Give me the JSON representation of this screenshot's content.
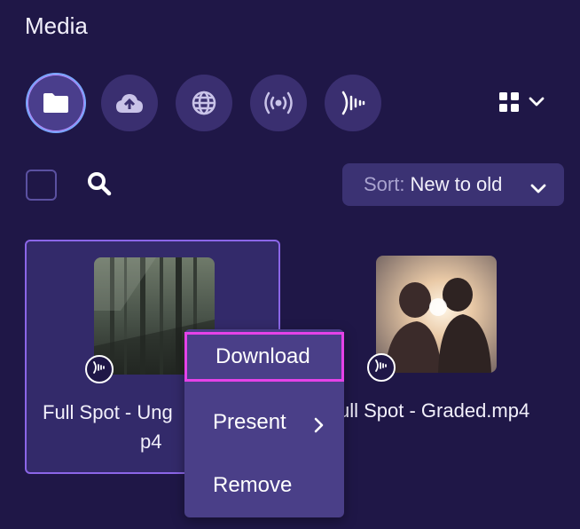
{
  "header": {
    "title": "Media"
  },
  "sources": [
    {
      "name": "folder",
      "icon": "folder-icon",
      "active": true
    },
    {
      "name": "cloud-upload",
      "icon": "cloud-upload-icon"
    },
    {
      "name": "web",
      "icon": "globe-icon"
    },
    {
      "name": "broadcast",
      "icon": "broadcast-icon"
    },
    {
      "name": "audio",
      "icon": "audio-wave-icon"
    }
  ],
  "toolbar": {
    "sort_label": "Sort:",
    "sort_value": "New to old"
  },
  "files": [
    {
      "name_line1": "Full Spot - Ung",
      "name_line2": "p4",
      "selected": true
    },
    {
      "name_line1": "ull Spot - Graded.mp4",
      "name_line2": ""
    }
  ],
  "context_menu": {
    "items": [
      {
        "label": "Download"
      },
      {
        "label": "Present"
      },
      {
        "label": "Remove"
      }
    ]
  },
  "colors": {
    "background": "#1f1747",
    "accent": "#8b66e8",
    "menu_highlight": "#e542e8"
  }
}
